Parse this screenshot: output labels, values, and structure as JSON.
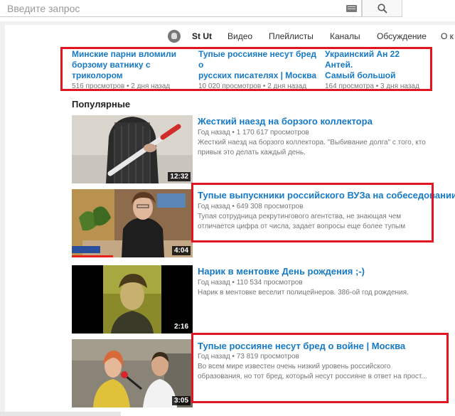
{
  "search": {
    "placeholder": "Введите запрос"
  },
  "channel_nav": {
    "channel_name": "St Ut",
    "tabs": [
      "Видео",
      "Плейлисты",
      "Каналы",
      "Обсуждение",
      "О к"
    ]
  },
  "mini_videos": [
    {
      "title_line1": "Минские парни вломили",
      "title_line2": "борзому ватнику с триколором",
      "meta": "516 просмотров • 2 дня назад"
    },
    {
      "title_line1": "Тупые россияне несут бред о",
      "title_line2": "русских писателях | Москва",
      "meta": "10 020 просмотров • 2 дня назад"
    },
    {
      "title_line1": "Украинский Ан 22 Антей.",
      "title_line2": "Самый большой",
      "meta": "164 просмотра • 3 дня назад"
    }
  ],
  "section": {
    "title": "Популярные"
  },
  "videos": [
    {
      "title": "Жесткий наезд на борзого коллектора",
      "meta": "Год назад • 1 170 617 просмотров",
      "desc_line1": "Жесткий наезд на борзого коллектора. \"Выбивание долга\" с того, кто",
      "desc_line2": "привык это делать каждый день.",
      "duration": "12:32"
    },
    {
      "title": "Тупые выпускники российского ВУЗа на собеседовании",
      "meta": "Год назад • 649 308 просмотров",
      "desc_line1": "Тупая сотрудница рекрутингового агентства, не знающая чем",
      "desc_line2": "отличается цифра от числа, задает вопросы еще более тупым",
      "duration": "4:04"
    },
    {
      "title": "Нарик в ментовке День рождения ;-)",
      "meta": "Год назад • 110 534 просмотров",
      "desc_line1": "Нарик в ментовке веселит полицейнеров. 386-ой год рождения.",
      "desc_line2": "",
      "duration": "2:16"
    },
    {
      "title": "Тупые россияне несут бред о войне | Москва",
      "meta": "Год назад • 73 819 просмотров",
      "desc_line1": "Во всем мире известен очень низкий уровень российского",
      "desc_line2": "образования, но тот бред, который несут россияне в ответ на прост...",
      "duration": "3:05"
    }
  ],
  "colors": {
    "link": "#167ac6",
    "highlight_box": "#e1141f",
    "meta_text": "#767676"
  }
}
